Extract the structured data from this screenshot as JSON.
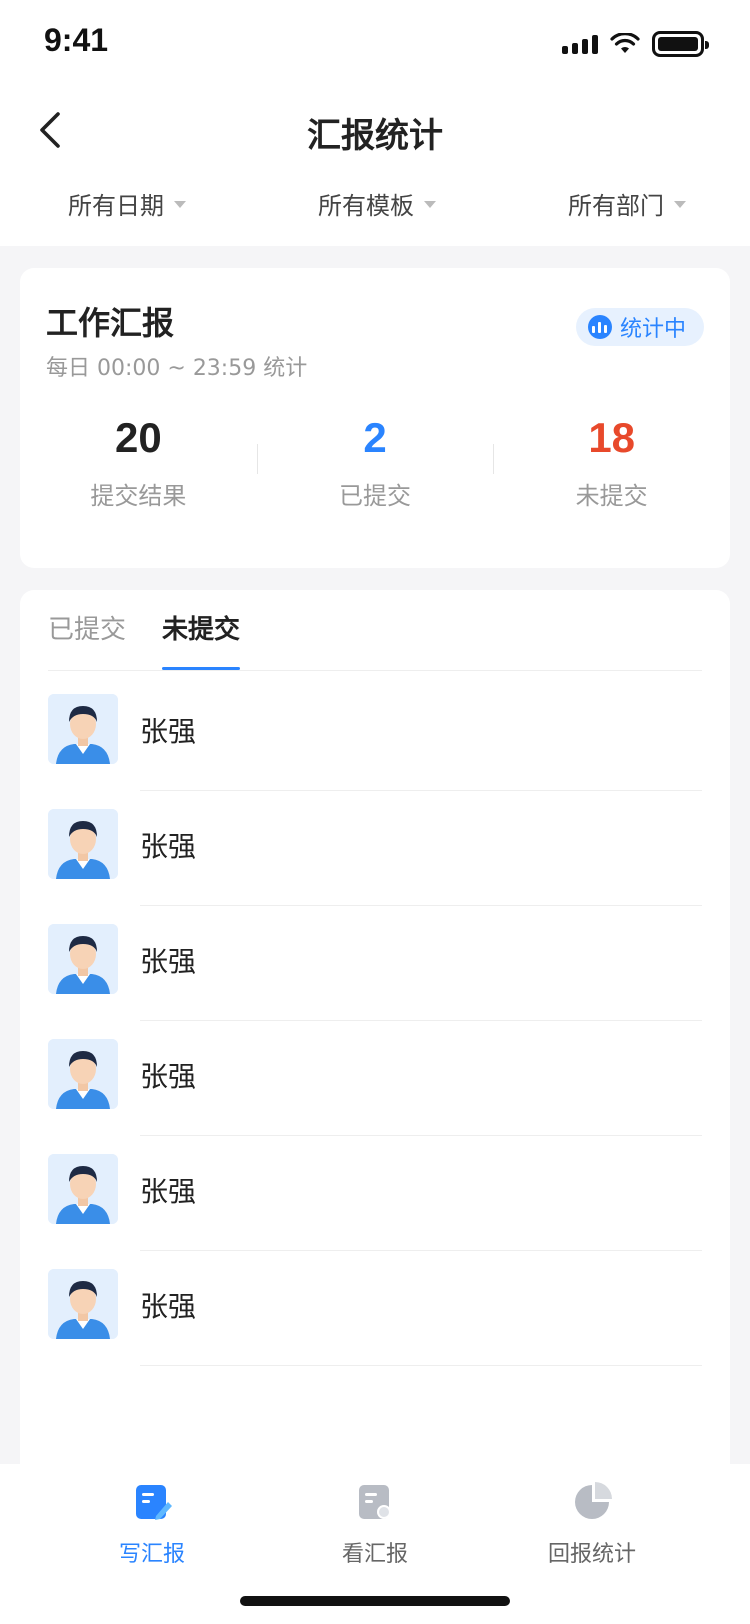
{
  "status_bar": {
    "time": "9:41"
  },
  "nav": {
    "title": "汇报统计"
  },
  "filters": [
    {
      "label": "所有日期"
    },
    {
      "label": "所有模板"
    },
    {
      "label": "所有部门"
    }
  ],
  "summary": {
    "title": "工作汇报",
    "subtitle": "每日 00:00 ~ 23:59 统计",
    "badge": "统计中",
    "stats": [
      {
        "value": "20",
        "label": "提交结果",
        "color": "#222222"
      },
      {
        "value": "2",
        "label": "已提交",
        "color": "#2a84ff"
      },
      {
        "value": "18",
        "label": "未提交",
        "color": "#e8492b"
      }
    ]
  },
  "tabs": [
    {
      "label": "已提交",
      "active": false
    },
    {
      "label": "未提交",
      "active": true
    }
  ],
  "people": [
    {
      "name": "张强"
    },
    {
      "name": "张强"
    },
    {
      "name": "张强"
    },
    {
      "name": "张强"
    },
    {
      "name": "张强"
    },
    {
      "name": "张强"
    }
  ],
  "tabbar": [
    {
      "label": "写汇报",
      "icon": "write-report-icon",
      "active": true
    },
    {
      "label": "看汇报",
      "icon": "view-report-icon",
      "active": false
    },
    {
      "label": "回报统计",
      "icon": "statistics-icon",
      "active": false
    }
  ],
  "colors": {
    "accent": "#2a84ff",
    "danger": "#e8492b"
  }
}
